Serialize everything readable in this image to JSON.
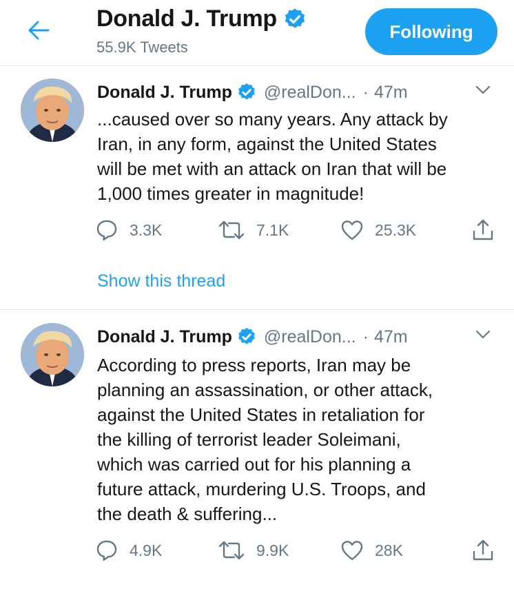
{
  "header": {
    "title": "Donald J. Trump",
    "subtitle": "55.9K Tweets",
    "follow_label": "Following"
  },
  "colors": {
    "accent": "#1da1f2",
    "text": "#14171a",
    "secondary": "#657786",
    "divider": "#e1e8ed"
  },
  "tweets": [
    {
      "author": "Donald J. Trump",
      "handle": "@realDon...",
      "dot": "·",
      "time": "47m",
      "lines": [
        "...caused over so many years. Any attack by",
        "Iran, in any form, against the United States",
        "will be met with an attack on Iran that will be",
        "1,000 times greater in magnitude!"
      ],
      "replies": "3.3K",
      "retweets": "7.1K",
      "likes": "25.3K",
      "show_thread": "Show this thread"
    },
    {
      "author": "Donald J. Trump",
      "handle": "@realDon...",
      "dot": "·",
      "time": "47m",
      "lines": [
        "According to press reports, Iran may be",
        "planning an assassination, or other attack,",
        "against the United States in retaliation for",
        "the killing of terrorist leader Soleimani,",
        "which was carried out for his planning a",
        "future attack, murdering U.S. Troops, and",
        "the death & suffering..."
      ],
      "replies": "4.9K",
      "retweets": "9.9K",
      "likes": "28K"
    }
  ]
}
